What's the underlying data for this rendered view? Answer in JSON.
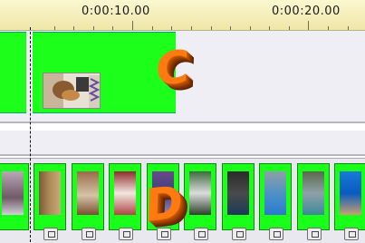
{
  "ruler": {
    "time_labels": [
      "0:00:10.00",
      "0:00:20.00"
    ]
  },
  "callouts": {
    "c": "C",
    "d": "D"
  },
  "colors": {
    "clip_green": "#19ff19",
    "track_bg": "#efeef4",
    "callout_orange": "#ff7a10"
  },
  "filmstrip": {
    "clip_count": 10
  }
}
